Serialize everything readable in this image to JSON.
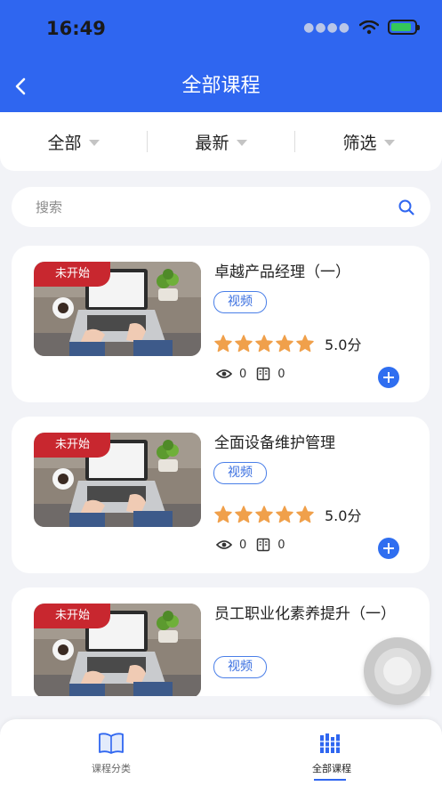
{
  "status_bar": {
    "time": "16:49"
  },
  "header": {
    "title": "全部课程"
  },
  "filters": [
    {
      "label": "全部"
    },
    {
      "label": "最新"
    },
    {
      "label": "筛选"
    }
  ],
  "search": {
    "placeholder": "搜索"
  },
  "courses": [
    {
      "badge": "未开始",
      "title": "卓越产品经理（一）",
      "tag": "视频",
      "score": "5.0分",
      "rating": 5,
      "views": "0",
      "lessons": "0"
    },
    {
      "badge": "未开始",
      "title": "全面设备维护管理",
      "tag": "视频",
      "score": "5.0分",
      "rating": 5,
      "views": "0",
      "lessons": "0"
    },
    {
      "badge": "未开始",
      "title": "员工职业化素养提升（一）",
      "tag": "视频"
    }
  ],
  "tabbar": [
    {
      "label": "课程分类",
      "active": false
    },
    {
      "label": "全部课程",
      "active": true
    }
  ],
  "colors": {
    "primary": "#2f66f0",
    "badge": "#c8272f",
    "star": "#f0a04b"
  }
}
